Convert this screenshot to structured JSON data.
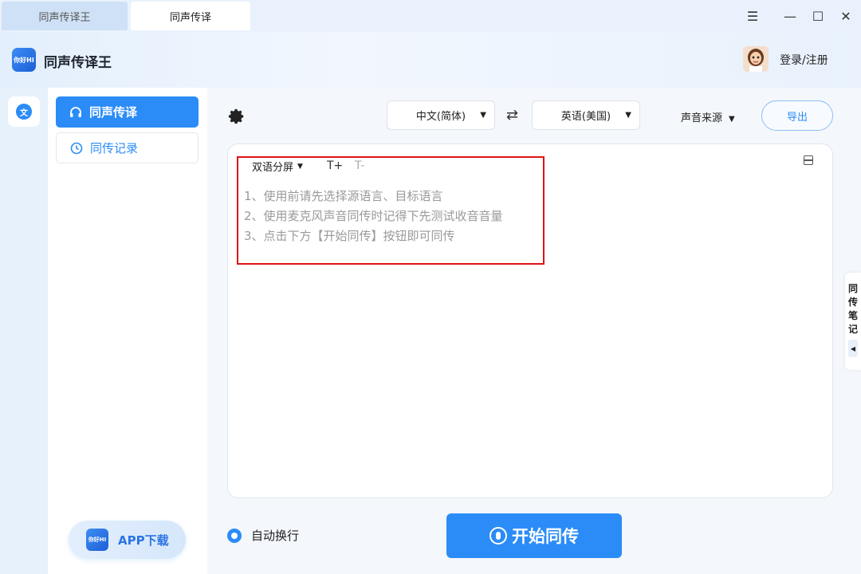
{
  "tabs": [
    {
      "label": "同声传译王"
    },
    {
      "label": "同声传译"
    }
  ],
  "window_controls": {
    "menu": "☰",
    "minimize": "—",
    "maximize": "☐",
    "close": "✕"
  },
  "header": {
    "app_title": "同声传译王",
    "logo_text": "你好HI",
    "login_label": "登录/注册"
  },
  "sidebar": {
    "items": [
      {
        "label": "同声传译",
        "icon": "headphones-icon",
        "active": true
      },
      {
        "label": "同传记录",
        "icon": "clock-icon",
        "active": false
      }
    ],
    "app_download_label": "APP下载"
  },
  "toolbar": {
    "source_language": "中文(简体)",
    "target_language": "英语(美国)",
    "swap_glyph": "⇄",
    "audio_source_label": "声音来源",
    "export_label": "导出"
  },
  "panel": {
    "view_mode": "双语分屏",
    "font_increase": "T+",
    "font_decrease": "T-",
    "hints": [
      "1、使用前请先选择源语言、目标语言",
      "2、使用麦克风声音同传时记得下先测试收音音量",
      "3、点击下方【开始同传】按钮即可同传"
    ]
  },
  "side_tab": {
    "chars": [
      "同",
      "传",
      "笔",
      "记"
    ],
    "pull_glyph": "◀"
  },
  "footer": {
    "auto_wrap_label": "自动换行",
    "auto_wrap_checked": true,
    "start_label": "开始同传"
  },
  "colors": {
    "accent": "#2b8cf7",
    "highlight_border": "#e01313"
  }
}
